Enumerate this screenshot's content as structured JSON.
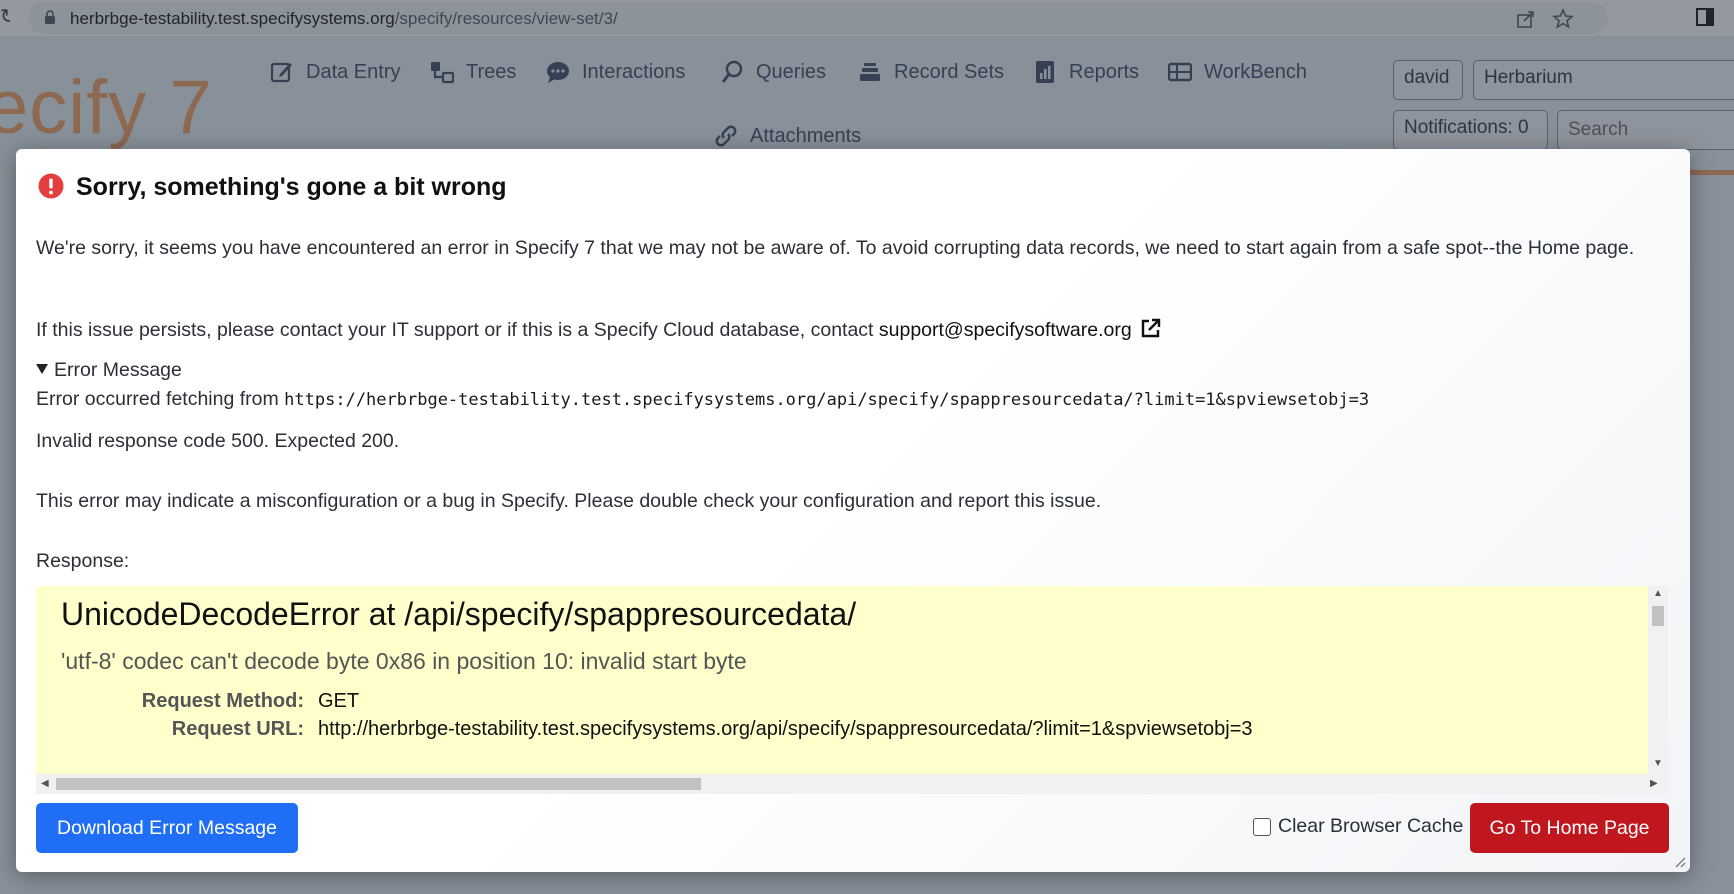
{
  "browser": {
    "url_host": "herbrbge-testability.test.specifysystems.org",
    "url_path": "/specify/resources/view-set/3/"
  },
  "app": {
    "logo_text": "ecify 7",
    "nav": [
      {
        "label": "Data Entry",
        "icon": "pencil-square-icon"
      },
      {
        "label": "Trees",
        "icon": "tree-nodes-icon"
      },
      {
        "label": "Interactions",
        "icon": "chat-bubble-icon"
      },
      {
        "label": "Queries",
        "icon": "search-query-icon"
      },
      {
        "label": "Record Sets",
        "icon": "stack-icon"
      },
      {
        "label": "Reports",
        "icon": "report-bars-icon"
      },
      {
        "label": "WorkBench",
        "icon": "table-icon"
      },
      {
        "label": "Attachments",
        "icon": "link-icon"
      }
    ],
    "user": "david",
    "collection": "Herbarium",
    "notifications": "Notifications: 0",
    "search_placeholder": "Search"
  },
  "dialog": {
    "title": "Sorry, something's gone a bit wrong",
    "intro": "We're sorry, it seems you have encountered an error in Specify 7 that we may not be aware of. To avoid corrupting data records, we need to start again from a safe spot--the Home page.",
    "contact_prefix": "If this issue persists, please contact your IT support or if this is a Specify Cloud database, contact ",
    "contact_email": "support@specifysoftware.org",
    "details_summary": "Error Message",
    "fetch_prefix": "Error occurred fetching from ",
    "fetch_url": "https://herbrbge-testability.test.specifysystems.org/api/specify/spappresourcedata/?limit=1&spviewsetobj=3",
    "invalid_code": "Invalid response code 500. Expected 200.",
    "misconfig": "This error may indicate a misconfiguration or a bug in Specify. Please double check your configuration and report this issue.",
    "response_label": "Response:",
    "response": {
      "heading": "UnicodeDecodeError at /api/specify/spappresourcedata/",
      "subheading": "'utf-8' codec can't decode byte 0x86 in position 10: invalid start byte",
      "rows": [
        {
          "key": "Request Method:",
          "value": "GET"
        },
        {
          "key": "Request URL:",
          "value": "http://herbrbge-testability.test.specifysystems.org/api/specify/spappresourcedata/?limit=1&spviewsetobj=3"
        }
      ]
    },
    "download_label": "Download Error Message",
    "clear_cache_label": "Clear Browser Cache",
    "clear_cache_checked": false,
    "home_label": "Go To Home Page"
  },
  "colors": {
    "primary": "#1f6ef5",
    "danger": "#c0171e",
    "error_icon": "#e53e3e",
    "response_bg": "#ffffcc",
    "brand_orange": "#f2a468"
  }
}
